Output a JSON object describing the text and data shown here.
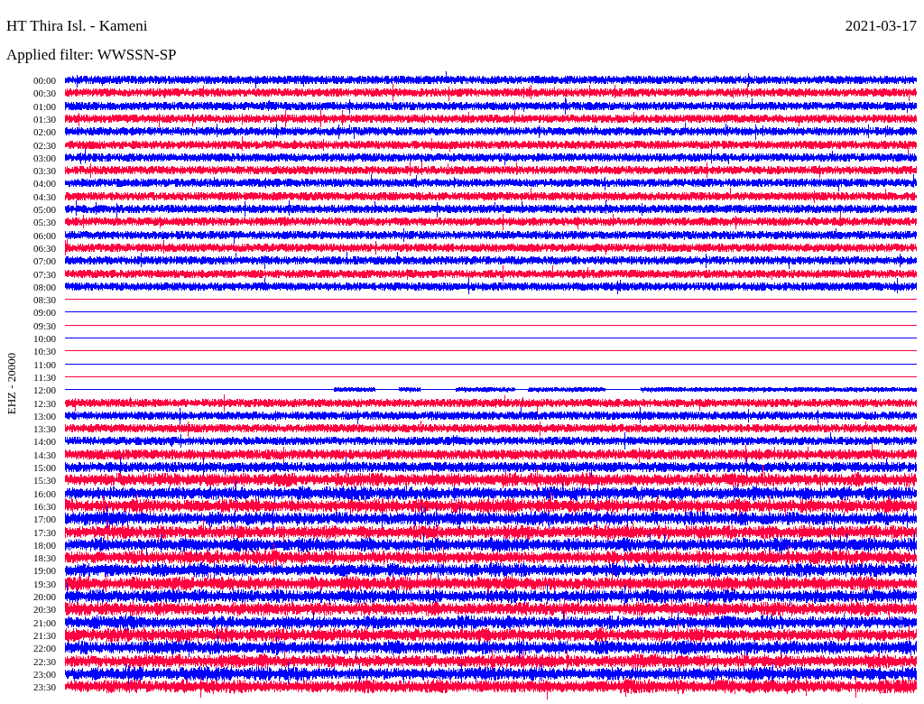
{
  "title": "HT Thira Isl. - Kameni",
  "date": "2021-03-17",
  "filter": "Applied filter: WWSSN-SP",
  "channel_label": "EHZ - 20000",
  "rows": [
    {
      "time": "00:00",
      "color": "#0000ff",
      "kind": "quiet"
    },
    {
      "time": "00:30",
      "color": "#ff0040",
      "kind": "quiet"
    },
    {
      "time": "01:00",
      "color": "#0000ff",
      "kind": "quiet"
    },
    {
      "time": "01:30",
      "color": "#ff0040",
      "kind": "quiet"
    },
    {
      "time": "02:00",
      "color": "#0000ff",
      "kind": "quiet"
    },
    {
      "time": "02:30",
      "color": "#ff0040",
      "kind": "quiet"
    },
    {
      "time": "03:00",
      "color": "#0000ff",
      "kind": "quiet"
    },
    {
      "time": "03:30",
      "color": "#ff0040",
      "kind": "quiet"
    },
    {
      "time": "04:00",
      "color": "#0000ff",
      "kind": "quiet"
    },
    {
      "time": "04:30",
      "color": "#ff0040",
      "kind": "quiet"
    },
    {
      "time": "05:00",
      "color": "#0000ff",
      "kind": "quiet"
    },
    {
      "time": "05:30",
      "color": "#ff0040",
      "kind": "quiet"
    },
    {
      "time": "06:00",
      "color": "#0000ff",
      "kind": "quiet"
    },
    {
      "time": "06:30",
      "color": "#ff0040",
      "kind": "quiet"
    },
    {
      "time": "07:00",
      "color": "#0000ff",
      "kind": "quiet"
    },
    {
      "time": "07:30",
      "color": "#ff0040",
      "kind": "quiet"
    },
    {
      "time": "08:00",
      "color": "#0000ff",
      "kind": "quiet"
    },
    {
      "time": "08:30",
      "color": "#ff0040",
      "kind": "flat"
    },
    {
      "time": "09:00",
      "color": "#0000ff",
      "kind": "flat"
    },
    {
      "time": "09:30",
      "color": "#ff0040",
      "kind": "flat"
    },
    {
      "time": "10:00",
      "color": "#0000ff",
      "kind": "flat"
    },
    {
      "time": "10:30",
      "color": "#ff0040",
      "kind": "flat"
    },
    {
      "time": "11:00",
      "color": "#0000ff",
      "kind": "flat"
    },
    {
      "time": "11:30",
      "color": "#ff0040",
      "kind": "flat"
    },
    {
      "time": "12:00",
      "color": "#0000ff",
      "kind": "partial"
    },
    {
      "time": "12:30",
      "color": "#ff0040",
      "kind": "quiet"
    },
    {
      "time": "13:00",
      "color": "#0000ff",
      "kind": "quiet"
    },
    {
      "time": "13:30",
      "color": "#ff0040",
      "kind": "quiet"
    },
    {
      "time": "14:00",
      "color": "#0000ff",
      "kind": "quiet"
    },
    {
      "time": "14:30",
      "color": "#ff0040",
      "kind": "medium"
    },
    {
      "time": "15:00",
      "color": "#0000ff",
      "kind": "medium"
    },
    {
      "time": "15:30",
      "color": "#ff0040",
      "kind": "loud"
    },
    {
      "time": "16:00",
      "color": "#0000ff",
      "kind": "loud"
    },
    {
      "time": "16:30",
      "color": "#ff0040",
      "kind": "loud"
    },
    {
      "time": "17:00",
      "color": "#0000ff",
      "kind": "loud"
    },
    {
      "time": "17:30",
      "color": "#ff0040",
      "kind": "loud"
    },
    {
      "time": "18:00",
      "color": "#0000ff",
      "kind": "loud"
    },
    {
      "time": "18:30",
      "color": "#ff0040",
      "kind": "loud"
    },
    {
      "time": "19:00",
      "color": "#0000ff",
      "kind": "loud"
    },
    {
      "time": "19:30",
      "color": "#ff0040",
      "kind": "loud"
    },
    {
      "time": "20:00",
      "color": "#0000ff",
      "kind": "loud"
    },
    {
      "time": "20:30",
      "color": "#ff0040",
      "kind": "loud"
    },
    {
      "time": "21:00",
      "color": "#0000ff",
      "kind": "loud"
    },
    {
      "time": "21:30",
      "color": "#ff0040",
      "kind": "loud"
    },
    {
      "time": "22:00",
      "color": "#0000ff",
      "kind": "loud"
    },
    {
      "time": "22:30",
      "color": "#ff0040",
      "kind": "loud"
    },
    {
      "time": "23:00",
      "color": "#0000ff",
      "kind": "loud"
    },
    {
      "time": "23:30",
      "color": "#ff0040",
      "kind": "loud"
    }
  ]
}
